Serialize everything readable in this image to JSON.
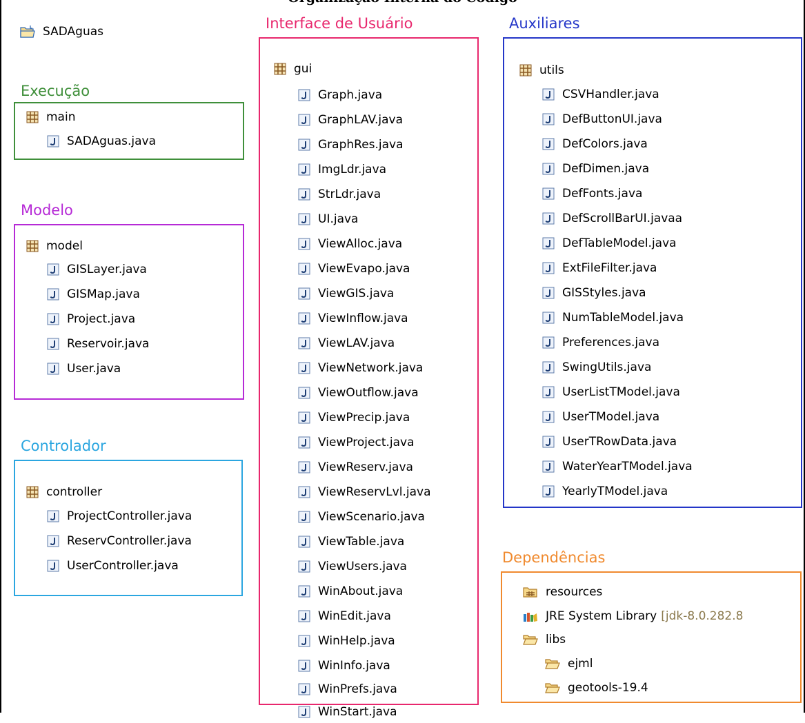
{
  "colors": {
    "execucao": "#3f8f3a",
    "modelo": "#b62ad6",
    "controlador": "#2ba6e0",
    "interface": "#e8276d",
    "auxiliares": "#2436c8",
    "dependencias": "#f08a2e"
  },
  "top_title": "Organização Interna do Código",
  "project": {
    "name": "SADAguas",
    "icon": "project-folder-icon"
  },
  "sections": {
    "execucao": {
      "title": "Execução",
      "package": "main",
      "files": [
        "SADAguas.java"
      ]
    },
    "modelo": {
      "title": "Modelo",
      "package": "model",
      "files": [
        "GISLayer.java",
        "GISMap.java",
        "Project.java",
        "Reservoir.java",
        "User.java"
      ]
    },
    "controlador": {
      "title": "Controlador",
      "package": "controller",
      "files": [
        "ProjectController.java",
        "ReservController.java",
        "UserController.java"
      ]
    },
    "interface": {
      "title": "Interface de Usuário",
      "package": "gui",
      "files": [
        "Graph.java",
        "GraphLAV.java",
        "GraphRes.java",
        "ImgLdr.java",
        "StrLdr.java",
        "UI.java",
        "ViewAlloc.java",
        "ViewEvapo.java",
        "ViewGIS.java",
        "ViewInflow.java",
        "ViewLAV.java",
        "ViewNetwork.java",
        "ViewOutflow.java",
        "ViewPrecip.java",
        "ViewProject.java",
        "ViewReserv.java",
        "ViewReservLvl.java",
        "ViewScenario.java",
        "ViewTable.java",
        "ViewUsers.java",
        "WinAbout.java",
        "WinEdit.java",
        "WinHelp.java",
        "WinInfo.java",
        "WinPrefs.java",
        "WinStart.java"
      ]
    },
    "auxiliares": {
      "title": "Auxiliares",
      "package": "utils",
      "files": [
        "CSVHandler.java",
        "DefButtonUI.java",
        "DefColors.java",
        "DefDimen.java",
        "DefFonts.java",
        "DefScrollBarUI.javaa",
        "DefTableModel.java",
        "ExtFileFilter.java",
        "GISStyles.java",
        "NumTableModel.java",
        "Preferences.java",
        "SwingUtils.java",
        "UserListTModel.java",
        "UserTModel.java",
        "UserTRowData.java",
        "WaterYearTModel.java",
        "YearlyTModel.java"
      ]
    },
    "dependencias": {
      "title": "Dependências",
      "resources": "resources",
      "jre_label": "JRE System Library",
      "jre_version": "[jdk-8.0.282.8",
      "libs": "libs",
      "lib_folders": [
        "ejml",
        "geotools-19.4"
      ]
    }
  }
}
